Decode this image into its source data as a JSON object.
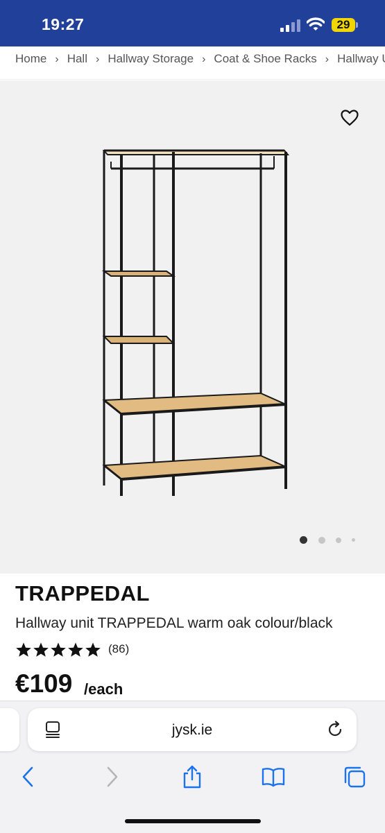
{
  "status_bar": {
    "time": "19:27",
    "battery": "29",
    "bar_color": "#21409a",
    "battery_color": "#f2d600"
  },
  "breadcrumb": [
    "Home",
    "Hall",
    "Hallway Storage",
    "Coat & Shoe Racks",
    "Hallway Units"
  ],
  "gallery": {
    "favourite_icon": "heart-outline-icon",
    "image_count": 4,
    "active_image_index": 0,
    "background": "#f1f1f1"
  },
  "product": {
    "brand": "TRAPPEDAL",
    "description": "Hallway unit TRAPPEDAL warm oak colour/black",
    "rating": 5,
    "review_count": "(86)",
    "price": "€109",
    "unit": "/each"
  },
  "browser": {
    "url": "jysk.ie",
    "reader_icon": "reader-mode-icon",
    "reload_icon": "reload-icon",
    "toolbar": [
      "back-icon",
      "forward-icon",
      "share-icon",
      "bookmarks-icon",
      "tabs-icon"
    ],
    "accent": "#1a73e8"
  }
}
